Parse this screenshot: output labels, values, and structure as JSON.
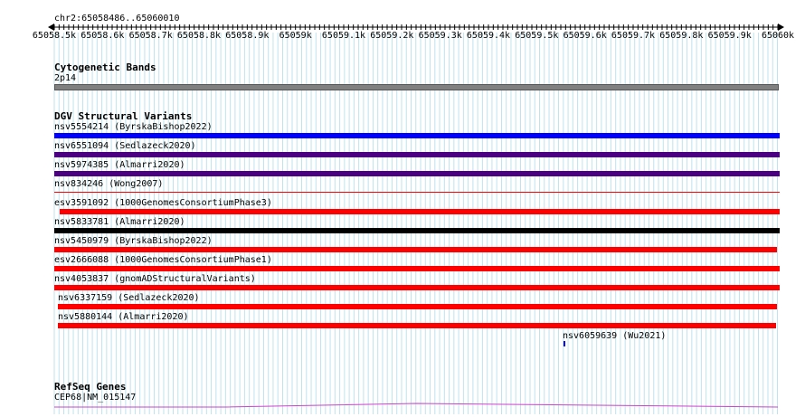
{
  "coordinate_label": "chr2:65058486..65060010",
  "ruler": {
    "ticks": [
      "65058.5k",
      "65058.6k",
      "65058.7k",
      "65058.8k",
      "65058.9k",
      "65059k",
      "65059.1k",
      "65059.2k",
      "65059.3k",
      "65059.4k",
      "65059.5k",
      "65059.6k",
      "65059.7k",
      "65059.8k",
      "65059.9k",
      "65060k"
    ]
  },
  "cytoband_track": {
    "title": "Cytogenetic Bands",
    "band": {
      "name": "2p14",
      "color": "#808080"
    }
  },
  "dgv_track": {
    "title": "DGV Structural Variants",
    "variants": [
      {
        "id": "nsv5554214",
        "source": "(ByrskaBishop2022)",
        "color": "#0000ff"
      },
      {
        "id": "nsv6551094",
        "source": "(Sedlazeck2020)",
        "color": "#4b0082"
      },
      {
        "id": "nsv5974385",
        "source": "(Almarri2020)",
        "color": "#4b0082"
      },
      {
        "id": "nsv834246",
        "source": "(Wong2007)",
        "color": "#ff0000"
      },
      {
        "id": "esv3591092",
        "source": "(1000GenomesConsortiumPhase3)",
        "color": "#ff0000"
      },
      {
        "id": "nsv5833781",
        "source": "(Almarri2020)",
        "color": "#000000"
      },
      {
        "id": "nsv5450979",
        "source": "(ByrskaBishop2022)",
        "color": "#ff0000"
      },
      {
        "id": "esv2666088",
        "source": "(1000GenomesConsortiumPhase1)",
        "color": "#ff0000"
      },
      {
        "id": "nsv4053837",
        "source": "(gnomADStructuralVariants)",
        "color": "#ff0000"
      },
      {
        "id": "nsv6337159",
        "source": "(Sedlazeck2020)",
        "color": "#ff0000"
      },
      {
        "id": "nsv5880144",
        "source": "(Almarri2020)",
        "color": "#ff0000"
      },
      {
        "id": "nsv6059639",
        "source": "(Wu2021)",
        "color": "#0000ff"
      }
    ]
  },
  "refseq_track": {
    "title": "RefSeq Genes",
    "gene_label": "CEP68|NM_015147",
    "color": "#cc44cc"
  }
}
